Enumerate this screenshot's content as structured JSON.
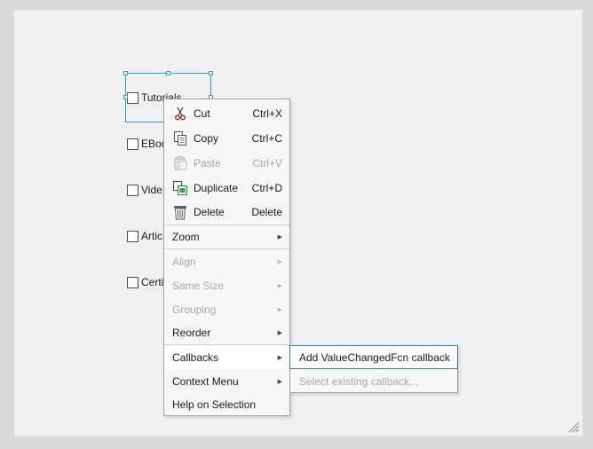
{
  "checkboxes": [
    {
      "label": "Tutorials",
      "checked": false
    },
    {
      "label": "EBoo",
      "checked": false
    },
    {
      "label": "Vide",
      "checked": false
    },
    {
      "label": "Artic",
      "checked": false
    },
    {
      "label": "Certi",
      "checked": false
    }
  ],
  "context_menu": {
    "cut": {
      "label": "Cut",
      "shortcut": "Ctrl+X",
      "icon": "scissors-icon"
    },
    "copy": {
      "label": "Copy",
      "shortcut": "Ctrl+C",
      "icon": "copy-icon"
    },
    "paste": {
      "label": "Paste",
      "shortcut": "Ctrl+V",
      "icon": "clipboard-icon",
      "disabled": true
    },
    "duplicate": {
      "label": "Duplicate",
      "shortcut": "Ctrl+D",
      "icon": "duplicate-icon"
    },
    "delete": {
      "label": "Delete",
      "shortcut": "Delete",
      "icon": "trash-icon"
    },
    "zoom": {
      "label": "Zoom"
    },
    "align": {
      "label": "Align",
      "disabled": true
    },
    "same_size": {
      "label": "Same Size",
      "disabled": true
    },
    "grouping": {
      "label": "Grouping",
      "disabled": true
    },
    "reorder": {
      "label": "Reorder"
    },
    "callbacks": {
      "label": "Callbacks",
      "highlighted": true
    },
    "context_menu": {
      "label": "Context Menu"
    },
    "help": {
      "label": "Help on Selection"
    }
  },
  "submenu": {
    "add_callback": {
      "label": "Add ValueChangedFcn callback"
    },
    "select_existing": {
      "label": "Select existing callback...",
      "disabled": true
    }
  },
  "colors": {
    "selection": "#2a9fd6",
    "canvas": "#f0f0f0",
    "menu_bg": "#f7f7f7",
    "disabled_text": "#a8a8a8",
    "focus_border": "#2a7fb8"
  }
}
